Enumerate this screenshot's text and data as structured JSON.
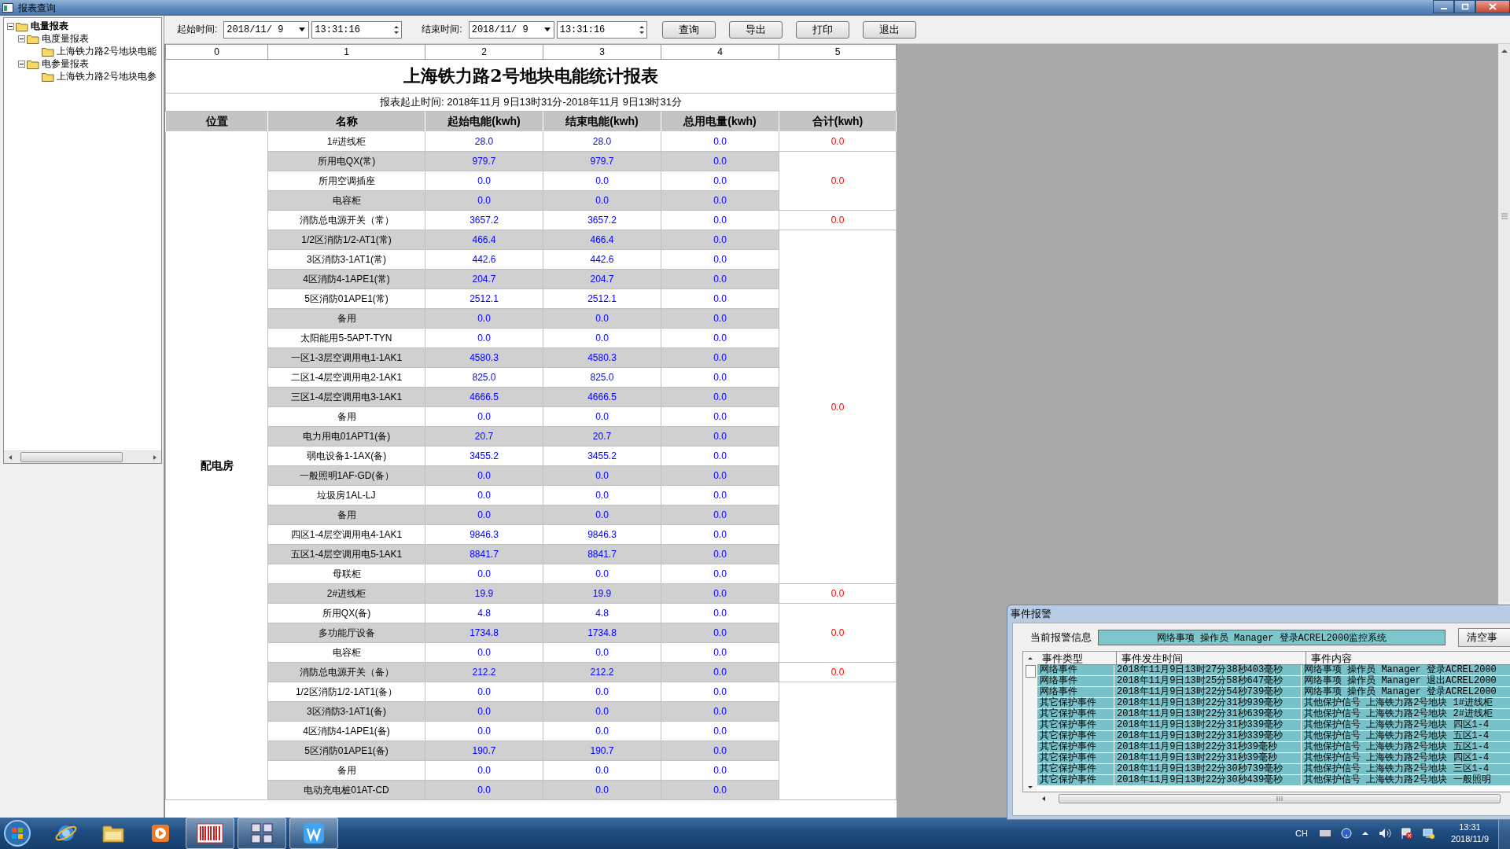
{
  "window": {
    "title": "报表查询"
  },
  "tree": [
    {
      "label": "电量报表",
      "expanded": true,
      "children": [
        {
          "label": "电度量报表",
          "expanded": true,
          "children": [
            {
              "label": "上海铁力路2号地块电能"
            }
          ]
        },
        {
          "label": "电参量报表",
          "expanded": true,
          "children": [
            {
              "label": "上海铁力路2号地块电参"
            }
          ]
        }
      ]
    }
  ],
  "toolbar": {
    "start_label": "起始时间:",
    "start_date": "2018/11/ 9",
    "start_time": "13:31:16",
    "end_label": "结束时间:",
    "end_date": "2018/11/ 9",
    "end_time": "13:31:16",
    "buttons": [
      "查询",
      "导出",
      "打印",
      "退出"
    ]
  },
  "grid_columns": [
    "0",
    "1",
    "2",
    "3",
    "4",
    "5"
  ],
  "report": {
    "title": "上海铁力路2号地块电能统计报表",
    "period": "报表起止时间: 2018年11月 9日13时31分-2018年11月 9日13时31分",
    "headers": [
      "位置",
      "名称",
      "起始电能(kwh)",
      "结束电能(kwh)",
      "总用电量(kwh)",
      "合计(kwh)"
    ],
    "location": "配电房",
    "groups": [
      {
        "total": "0.0",
        "rows": [
          {
            "name": "1#进线柜",
            "start": "28.0",
            "end": "28.0",
            "used": "0.0"
          }
        ]
      },
      {
        "total": "0.0",
        "rows": [
          {
            "name": "所用电QX(常)",
            "start": "979.7",
            "end": "979.7",
            "used": "0.0"
          },
          {
            "name": "所用空调插座",
            "start": "0.0",
            "end": "0.0",
            "used": "0.0"
          },
          {
            "name": "电容柜",
            "start": "0.0",
            "end": "0.0",
            "used": "0.0"
          }
        ]
      },
      {
        "total": "0.0",
        "rows": [
          {
            "name": "消防总电源开关（常）",
            "start": "3657.2",
            "end": "3657.2",
            "used": "0.0"
          }
        ]
      },
      {
        "total": "0.0",
        "rows": [
          {
            "name": "1/2区消防1/2-AT1(常)",
            "start": "466.4",
            "end": "466.4",
            "used": "0.0"
          },
          {
            "name": "3区消防3-1AT1(常)",
            "start": "442.6",
            "end": "442.6",
            "used": "0.0"
          },
          {
            "name": "4区消防4-1APE1(常)",
            "start": "204.7",
            "end": "204.7",
            "used": "0.0"
          },
          {
            "name": "5区消防01APE1(常)",
            "start": "2512.1",
            "end": "2512.1",
            "used": "0.0"
          },
          {
            "name": "备用",
            "start": "0.0",
            "end": "0.0",
            "used": "0.0"
          },
          {
            "name": "太阳能用5-5APT-TYN",
            "start": "0.0",
            "end": "0.0",
            "used": "0.0"
          },
          {
            "name": "一区1-3层空调用电1-1AK1",
            "start": "4580.3",
            "end": "4580.3",
            "used": "0.0"
          },
          {
            "name": "二区1-4层空调用电2-1AK1",
            "start": "825.0",
            "end": "825.0",
            "used": "0.0"
          },
          {
            "name": "三区1-4层空调用电3-1AK1",
            "start": "4666.5",
            "end": "4666.5",
            "used": "0.0"
          },
          {
            "name": "备用",
            "start": "0.0",
            "end": "0.0",
            "used": "0.0"
          },
          {
            "name": "电力用电01APT1(备)",
            "start": "20.7",
            "end": "20.7",
            "used": "0.0"
          },
          {
            "name": "弱电设备1-1AX(备)",
            "start": "3455.2",
            "end": "3455.2",
            "used": "0.0"
          },
          {
            "name": "一般照明1AF-GD(备）",
            "start": "0.0",
            "end": "0.0",
            "used": "0.0"
          },
          {
            "name": "垃圾房1AL-LJ",
            "start": "0.0",
            "end": "0.0",
            "used": "0.0"
          },
          {
            "name": "备用",
            "start": "0.0",
            "end": "0.0",
            "used": "0.0"
          },
          {
            "name": "四区1-4层空调用电4-1AK1",
            "start": "9846.3",
            "end": "9846.3",
            "used": "0.0"
          },
          {
            "name": "五区1-4层空调用电5-1AK1",
            "start": "8841.7",
            "end": "8841.7",
            "used": "0.0"
          },
          {
            "name": "母联柜",
            "start": "0.0",
            "end": "0.0",
            "used": "0.0"
          }
        ]
      },
      {
        "total": "0.0",
        "rows": [
          {
            "name": "2#进线柜",
            "start": "19.9",
            "end": "19.9",
            "used": "0.0"
          }
        ]
      },
      {
        "total": "0.0",
        "rows": [
          {
            "name": "所用QX(备)",
            "start": "4.8",
            "end": "4.8",
            "used": "0.0"
          },
          {
            "name": "多功能厅设备",
            "start": "1734.8",
            "end": "1734.8",
            "used": "0.0"
          },
          {
            "name": "电容柜",
            "start": "0.0",
            "end": "0.0",
            "used": "0.0"
          }
        ]
      },
      {
        "total": "0.0",
        "rows": [
          {
            "name": "消防总电源开关（备）",
            "start": "212.2",
            "end": "212.2",
            "used": "0.0"
          }
        ]
      },
      {
        "rows": [
          {
            "name": "1/2区消防1/2-1AT1(备）",
            "start": "0.0",
            "end": "0.0",
            "used": "0.0"
          },
          {
            "name": "3区消防3-1AT1(备)",
            "start": "0.0",
            "end": "0.0",
            "used": "0.0"
          },
          {
            "name": "4区消防4-1APE1(备)",
            "start": "0.0",
            "end": "0.0",
            "used": "0.0"
          },
          {
            "name": "5区消防01APE1(备)",
            "start": "190.7",
            "end": "190.7",
            "used": "0.0"
          },
          {
            "name": "备用",
            "start": "0.0",
            "end": "0.0",
            "used": "0.0"
          },
          {
            "name": "电动充电桩01AT-CD",
            "start": "0.0",
            "end": "0.0",
            "used": "0.0"
          }
        ]
      }
    ]
  },
  "event_panel": {
    "title": "事件报警",
    "current_label": "当前报警信息",
    "current_message": "网络事项 操作员 Manager 登录ACREL2000监控系统",
    "clear_button": "清空事",
    "columns": [
      "事件类型",
      "事件发生时间",
      "事件内容"
    ],
    "rows": [
      {
        "type": "网络事件",
        "time": "2018年11月9日13时27分38秒403毫秒",
        "content": "网络事项 操作员 Manager 登录ACREL2000"
      },
      {
        "type": "网络事件",
        "time": "2018年11月9日13时25分58秒647毫秒",
        "content": "网络事项 操作员 Manager 退出ACREL2000"
      },
      {
        "type": "网络事件",
        "time": "2018年11月9日13时22分54秒739毫秒",
        "content": "网络事项 操作员 Manager 登录ACREL2000"
      },
      {
        "type": "其它保护事件",
        "time": "2018年11月9日13时22分31秒939毫秒",
        "content": "其他保护信号 上海铁力路2号地块 1#进线柜"
      },
      {
        "type": "其它保护事件",
        "time": "2018年11月9日13时22分31秒639毫秒",
        "content": "其他保护信号 上海铁力路2号地块 2#进线柜"
      },
      {
        "type": "其它保护事件",
        "time": "2018年11月9日13时22分31秒339毫秒",
        "content": "其他保护信号 上海铁力路2号地块 四区1-4"
      },
      {
        "type": "其它保护事件",
        "time": "2018年11月9日13时22分31秒339毫秒",
        "content": "其他保护信号 上海铁力路2号地块 五区1-4"
      },
      {
        "type": "其它保护事件",
        "time": "2018年11月9日13时22分31秒39毫秒",
        "content": "其他保护信号 上海铁力路2号地块 五区1-4"
      },
      {
        "type": "其它保护事件",
        "time": "2018年11月9日13时22分31秒39毫秒",
        "content": "其他保护信号 上海铁力路2号地块 四区1-4"
      },
      {
        "type": "其它保护事件",
        "time": "2018年11月9日13时22分30秒739毫秒",
        "content": "其他保护信号 上海铁力路2号地块 三区1-4"
      },
      {
        "type": "其它保护事件",
        "time": "2018年11月9日13时22分30秒439毫秒",
        "content": "其他保护信号 上海铁力路2号地块 一般照明"
      }
    ]
  },
  "taskbar": {
    "language": "CH",
    "clock_time": "13:31",
    "clock_date": "2018/11/9"
  }
}
